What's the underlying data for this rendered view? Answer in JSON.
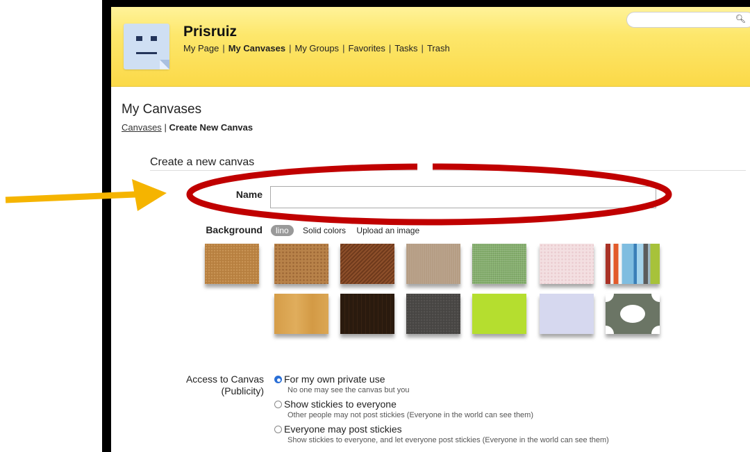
{
  "header": {
    "username": "Prisruiz",
    "nav": [
      "My Page",
      "My Canvases",
      "My Groups",
      "Favorites",
      "Tasks",
      "Trash"
    ],
    "active_nav": "My Canvases",
    "search_placeholder": ""
  },
  "page": {
    "title": "My Canvases",
    "breadcrumb_link": "Canvases",
    "breadcrumb_separator": "|",
    "breadcrumb_current": "Create New Canvas",
    "section_title": "Create a new canvas"
  },
  "form": {
    "name_label": "Name",
    "name_value": "",
    "background_label": "Background",
    "background_tabs": [
      "lino",
      "Solid colors",
      "Upload an image"
    ],
    "background_selected_tab": "lino",
    "access_label_line1": "Access to Canvas",
    "access_label_line2": "(Publicity)",
    "options": [
      {
        "label": "For my own private use",
        "description": "No one may see the canvas but you",
        "selected": true
      },
      {
        "label": "Show stickies to everyone",
        "description": "Other people may not post stickies (Everyone in the world can see them)",
        "selected": false
      },
      {
        "label": "Everyone may post stickies",
        "description": "Show stickies to everyone, and let everyone post stickies (Everyone in the world can see them)",
        "selected": false
      }
    ]
  },
  "swatches": [
    {
      "name": "cork",
      "color": "#b77f3f"
    },
    {
      "name": "cork-light",
      "color": "#b88249"
    },
    {
      "name": "wood-diagonal",
      "color": "#8d4f2a"
    },
    {
      "name": "linen",
      "color": "#b59d84"
    },
    {
      "name": "green-fabric",
      "color": "#84ae6c"
    },
    {
      "name": "pink-paper",
      "color": "#f3dfe1"
    },
    {
      "name": "stripes",
      "color": "#7fbde0"
    },
    {
      "name": "light-wood",
      "color": "#d9a44f"
    },
    {
      "name": "dark-wood",
      "color": "#2a1a0e"
    },
    {
      "name": "dark-gray",
      "color": "#474543"
    },
    {
      "name": "lime",
      "color": "#b5de2f"
    },
    {
      "name": "lavender",
      "color": "#d6d8ef"
    },
    {
      "name": "circle-pattern",
      "color": "#6b7565"
    }
  ],
  "annotation": {
    "arrow_color": "#f5b400",
    "ellipse_color": "#c00000"
  }
}
